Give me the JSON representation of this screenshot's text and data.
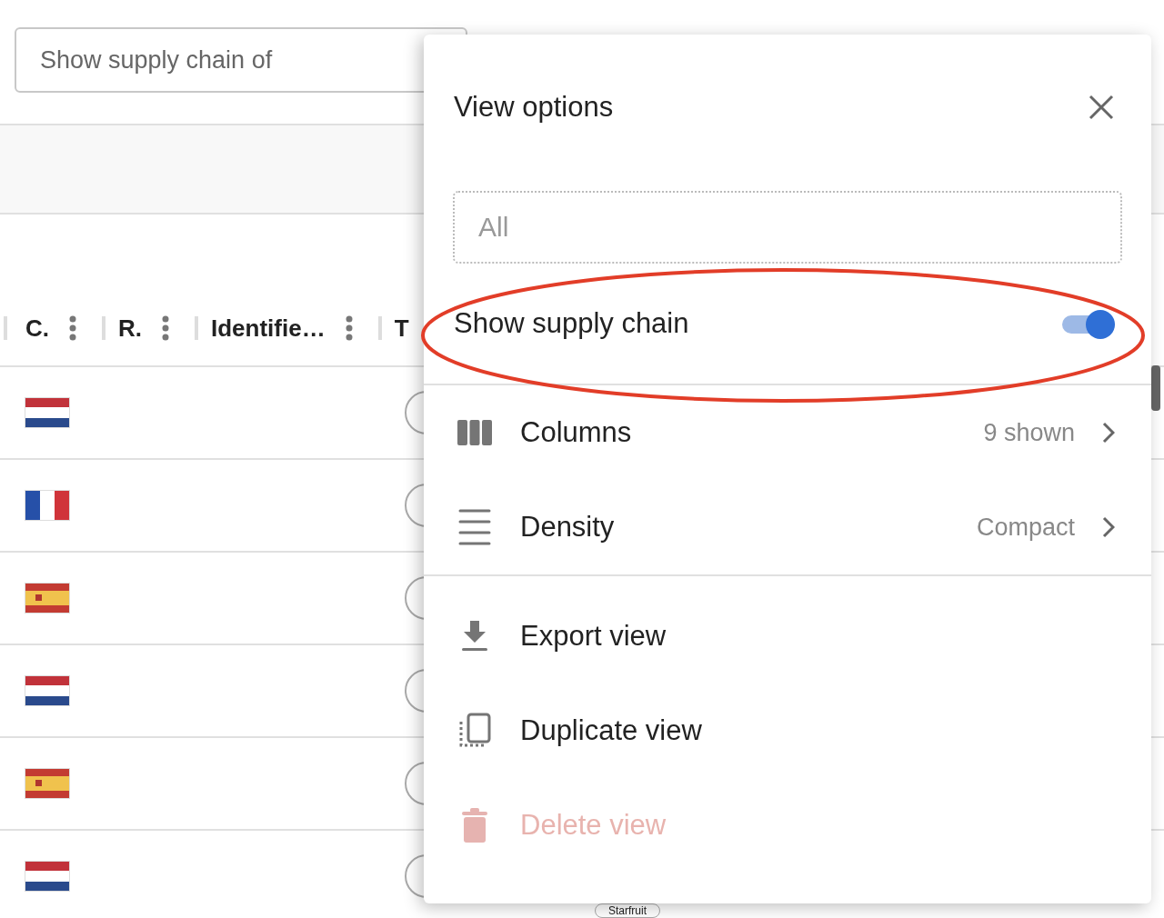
{
  "supply_chain_select": {
    "placeholder": "Show supply chain of"
  },
  "table": {
    "columns": [
      {
        "label": "C."
      },
      {
        "label": "R."
      },
      {
        "label": "Identifie…"
      },
      {
        "label": "T"
      }
    ],
    "rows": [
      {
        "flag": {
          "kind": "nl"
        }
      },
      {
        "flag": {
          "kind": "fr"
        }
      },
      {
        "flag": {
          "kind": "es"
        }
      },
      {
        "flag": {
          "kind": "nl"
        }
      },
      {
        "flag": {
          "kind": "es"
        }
      },
      {
        "flag": {
          "kind": "nl"
        }
      }
    ],
    "chip_below": "Starfruit"
  },
  "view_options": {
    "title": "View options",
    "search": {
      "placeholder": "All"
    },
    "toggle": {
      "label": "Show supply chain",
      "on": true
    },
    "items": [
      {
        "kind": "columns",
        "label": "Columns",
        "value": "9 shown",
        "disabled": false
      },
      {
        "kind": "density",
        "label": "Density",
        "value": "Compact",
        "disabled": false
      },
      {
        "kind": "export",
        "label": "Export view",
        "disabled": false
      },
      {
        "kind": "duplicate",
        "label": "Duplicate view",
        "disabled": false
      },
      {
        "kind": "delete",
        "label": "Delete view",
        "disabled": true
      }
    ]
  }
}
